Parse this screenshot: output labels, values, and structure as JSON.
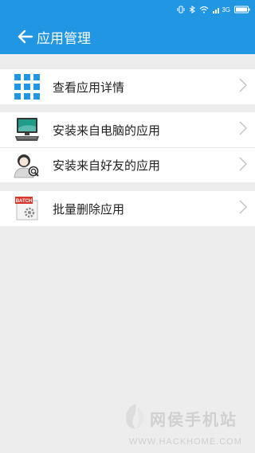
{
  "status_bar": {
    "network": "3G"
  },
  "header": {
    "title": "应用管理"
  },
  "groups": [
    {
      "items": [
        {
          "label": "查看应用详情",
          "icon": "grid-apps-icon"
        }
      ]
    },
    {
      "items": [
        {
          "label": "安装来自电脑的应用",
          "icon": "computer-icon"
        },
        {
          "label": "安装来自好友的应用",
          "icon": "friend-search-icon"
        }
      ]
    },
    {
      "items": [
        {
          "label": "批量删除应用",
          "icon": "batch-icon",
          "badge": "BATCH"
        }
      ]
    }
  ],
  "watermark": {
    "name": "网侯手机站",
    "url": "WWW.HACKHOME.COM"
  },
  "colors": {
    "primary": "#2196e3",
    "background": "#ededed"
  }
}
